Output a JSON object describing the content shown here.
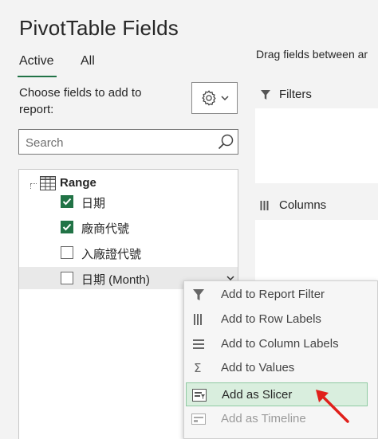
{
  "panel": {
    "title": "PivotTable Fields",
    "tabs": [
      {
        "label": "Active"
      },
      {
        "label": "All"
      }
    ],
    "choose_label": "Choose fields to add to report:",
    "search_placeholder": "Search"
  },
  "field_list": {
    "table_name": "Range",
    "fields": [
      {
        "label": "日期",
        "checked": true
      },
      {
        "label": "廠商代號",
        "checked": true
      },
      {
        "label": "入廠證代號",
        "checked": false
      },
      {
        "label": "日期 (Month)",
        "checked": false
      }
    ]
  },
  "areas": {
    "drag_hint": "Drag fields between ar",
    "filters": "Filters",
    "columns": "Columns"
  },
  "context_menu": {
    "items": [
      {
        "label": "Add to Report Filter",
        "icon": "filter-icon"
      },
      {
        "label": "Add to Row Labels",
        "icon": "rows-icon"
      },
      {
        "label": "Add to Column Labels",
        "icon": "columns-icon"
      },
      {
        "label": "Add to Values",
        "icon": "sigma-icon"
      },
      {
        "label": "Add as Slicer",
        "icon": "slicer-icon"
      },
      {
        "label": "Add as Timeline",
        "icon": "timeline-icon"
      }
    ]
  },
  "colors": {
    "accent": "#217346",
    "highlight": "#d9eede",
    "annotation": "#e0201b"
  }
}
